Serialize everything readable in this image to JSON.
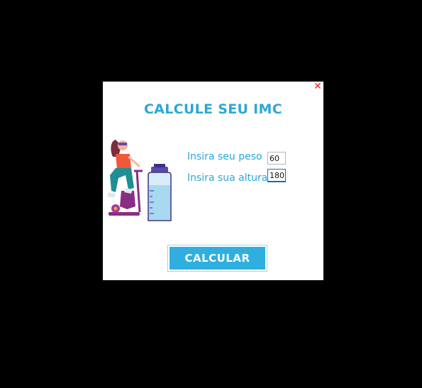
{
  "dialog": {
    "title": "CALCULE SEU IMC",
    "close_icon": "close-icon",
    "close_glyph": "✕",
    "illustration_icon": "woman-exercise-bike-water-bottle-illustration"
  },
  "form": {
    "weight_label": "Insira seu peso",
    "weight_value": "60",
    "height_label": "Insira sua altura",
    "height_value": "180"
  },
  "button": {
    "calculate_label": "CALCULAR"
  },
  "colors": {
    "accent": "#2da7d8",
    "button": "#2eafe0",
    "close": "#e02020",
    "background": "#000000"
  }
}
